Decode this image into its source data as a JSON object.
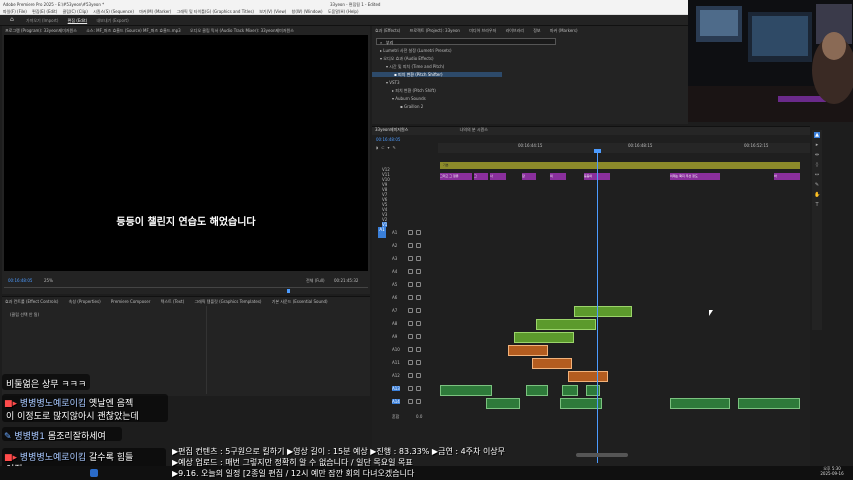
{
  "app": {
    "title": "Adobe Premiere Pro 2025 - E:\\#53yeon\\#53yeon *",
    "window_title": "33yeon - 편집됨 1 - Edited"
  },
  "menu": [
    "파일(F) (File)",
    "편집(E) (Edit)",
    "클립(C) (Clip)",
    "시퀀스(S) (Sequence)",
    "마커(M) (Marker)",
    "그래픽 및 타이틀(G) (Graphics and Titles)",
    "보기(V) (View)",
    "창(W) (Window)",
    "도움말(H) (Help)"
  ],
  "workspaces": [
    {
      "label": "가져오기 (Import)",
      "active": false
    },
    {
      "label": "편집 (Edit)",
      "active": true
    },
    {
      "label": "내보내기 (Export)",
      "active": false
    }
  ],
  "program_monitor": {
    "tabs": [
      "프로그램 (Program): 33yeon제미저원스",
      "소스: MF_퍼즈 효율드 (Source) MF_퍼즈 효율드.mp3",
      "오디오 클립 믹서 (Audio Track Mixer): 33yeon제미저원스"
    ],
    "subtitle": "등등이 챌린지 연습도 해었습니다",
    "current_tc": "00:16:48:05",
    "fit": "25%",
    "quality": "전체 (Full)",
    "duration_tc": "00:21:45:32"
  },
  "effects_panel": {
    "tabs": [
      "효과 컨트롤 (Effect Controls)",
      "속성 (Properties)",
      "Premiere Composer",
      "텍스트 (Text)",
      "그래픽 템플릿 (Graphics Templates)",
      "기본 사운드 (Essential Sound)"
    ],
    "empty_text": "(클립 선택 안 됨)"
  },
  "fx_browser": {
    "tabs": [
      "효과 (Effects)",
      "프로젝트 (Project): 33yeon",
      "미디어 브라우저",
      "라이브러리",
      "정보",
      "마커 (Markers)"
    ],
    "search_value": "부리",
    "tree": [
      {
        "label": "Lumetri 사전 설정 (Lumetri Presets)",
        "selected": false
      },
      {
        "label": "오디오 효과 (Audio Effects)",
        "selected": false
      },
      {
        "label": "시간 및 피치 (Time and Pitch)",
        "selected": false
      },
      {
        "label": "피치 변환 (Pitch Shifter)",
        "selected": true
      },
      {
        "label": "VST3",
        "selected": false
      },
      {
        "label": "피치 변환 (Pitch Shift)",
        "selected": false
      },
      {
        "label": "Auburn Sounds",
        "selected": false
      },
      {
        "label": "Graillon 2",
        "selected": false
      }
    ]
  },
  "timeline": {
    "tabs": [
      "33yeon제미저원스",
      "나의의 분 시퀀스"
    ],
    "timecode": "00:16:48:05",
    "ruler_labels": [
      "00:16:44:15",
      "00:16:48:15",
      "00:16:52:15"
    ],
    "video_tracks": [
      "V12",
      "V11",
      "V10",
      "V9",
      "V8",
      "V7",
      "V6",
      "V5",
      "V4",
      "V3",
      "V2",
      "V1"
    ],
    "audio_tracks": [
      "A1",
      "A2",
      "A3",
      "A4",
      "A5",
      "A6",
      "A7",
      "A8",
      "A9",
      "A10",
      "A11",
      "A12",
      "A13",
      "A14"
    ],
    "master_label": "혼합",
    "master_value": "0.0",
    "purple_clips": [
      "그리고 그 정류",
      "그",
      "사",
      "잡",
      "의",
      "등등이",
      "이제는 확지 우선 정도",
      "바"
    ],
    "olive_clip": "기본"
  },
  "tools": [
    "select",
    "track-select",
    "ripple",
    "razor",
    "slip",
    "pen",
    "hand",
    "type"
  ],
  "chat": {
    "line1": "비둘얾은 상무 ㅋㅋㅋ",
    "msg2_user": "병병병노예로이킴",
    "msg2_text1": "옛날엔 음젝",
    "msg2_text2": "이 이정도로 많지않아시 괜찮았는데",
    "msg3_user": "병병병1",
    "msg3_text": "몸조리잘하세여",
    "msg4_user": "병병병노예로이킴",
    "msg4_text1": "갈수록 힘들",
    "msg4_text2": "어짐"
  },
  "overlay": {
    "line1": "▶편집 컨텐츠 : 5구원으로 킬하기 ▶영상 길이 : 15분 예상 ▶진행 : 83.33% ▶금연 : 4주차 이상무",
    "line2": "▶예상 업로드 : 매번 그렇지만 정확히 알 수 없습니다 / 일단 목요일 목표",
    "line3": "▶9.16. 오늘의 일정 [2종일 편집 / 12시 예만 잠깐 회의 다녀오겠습니다"
  },
  "taskbar": {
    "time": "오후 5:30",
    "date": "2025-09-16"
  },
  "colors": {
    "accent_blue": "#3a7fd9",
    "timecode_blue": "#4c9bff",
    "clip_green": "#5c9a2c",
    "clip_orange": "#b35c1f",
    "clip_purple": "#8a2f9d",
    "clip_olive": "#8c8a2a",
    "audio_green": "#2e7a3a"
  }
}
